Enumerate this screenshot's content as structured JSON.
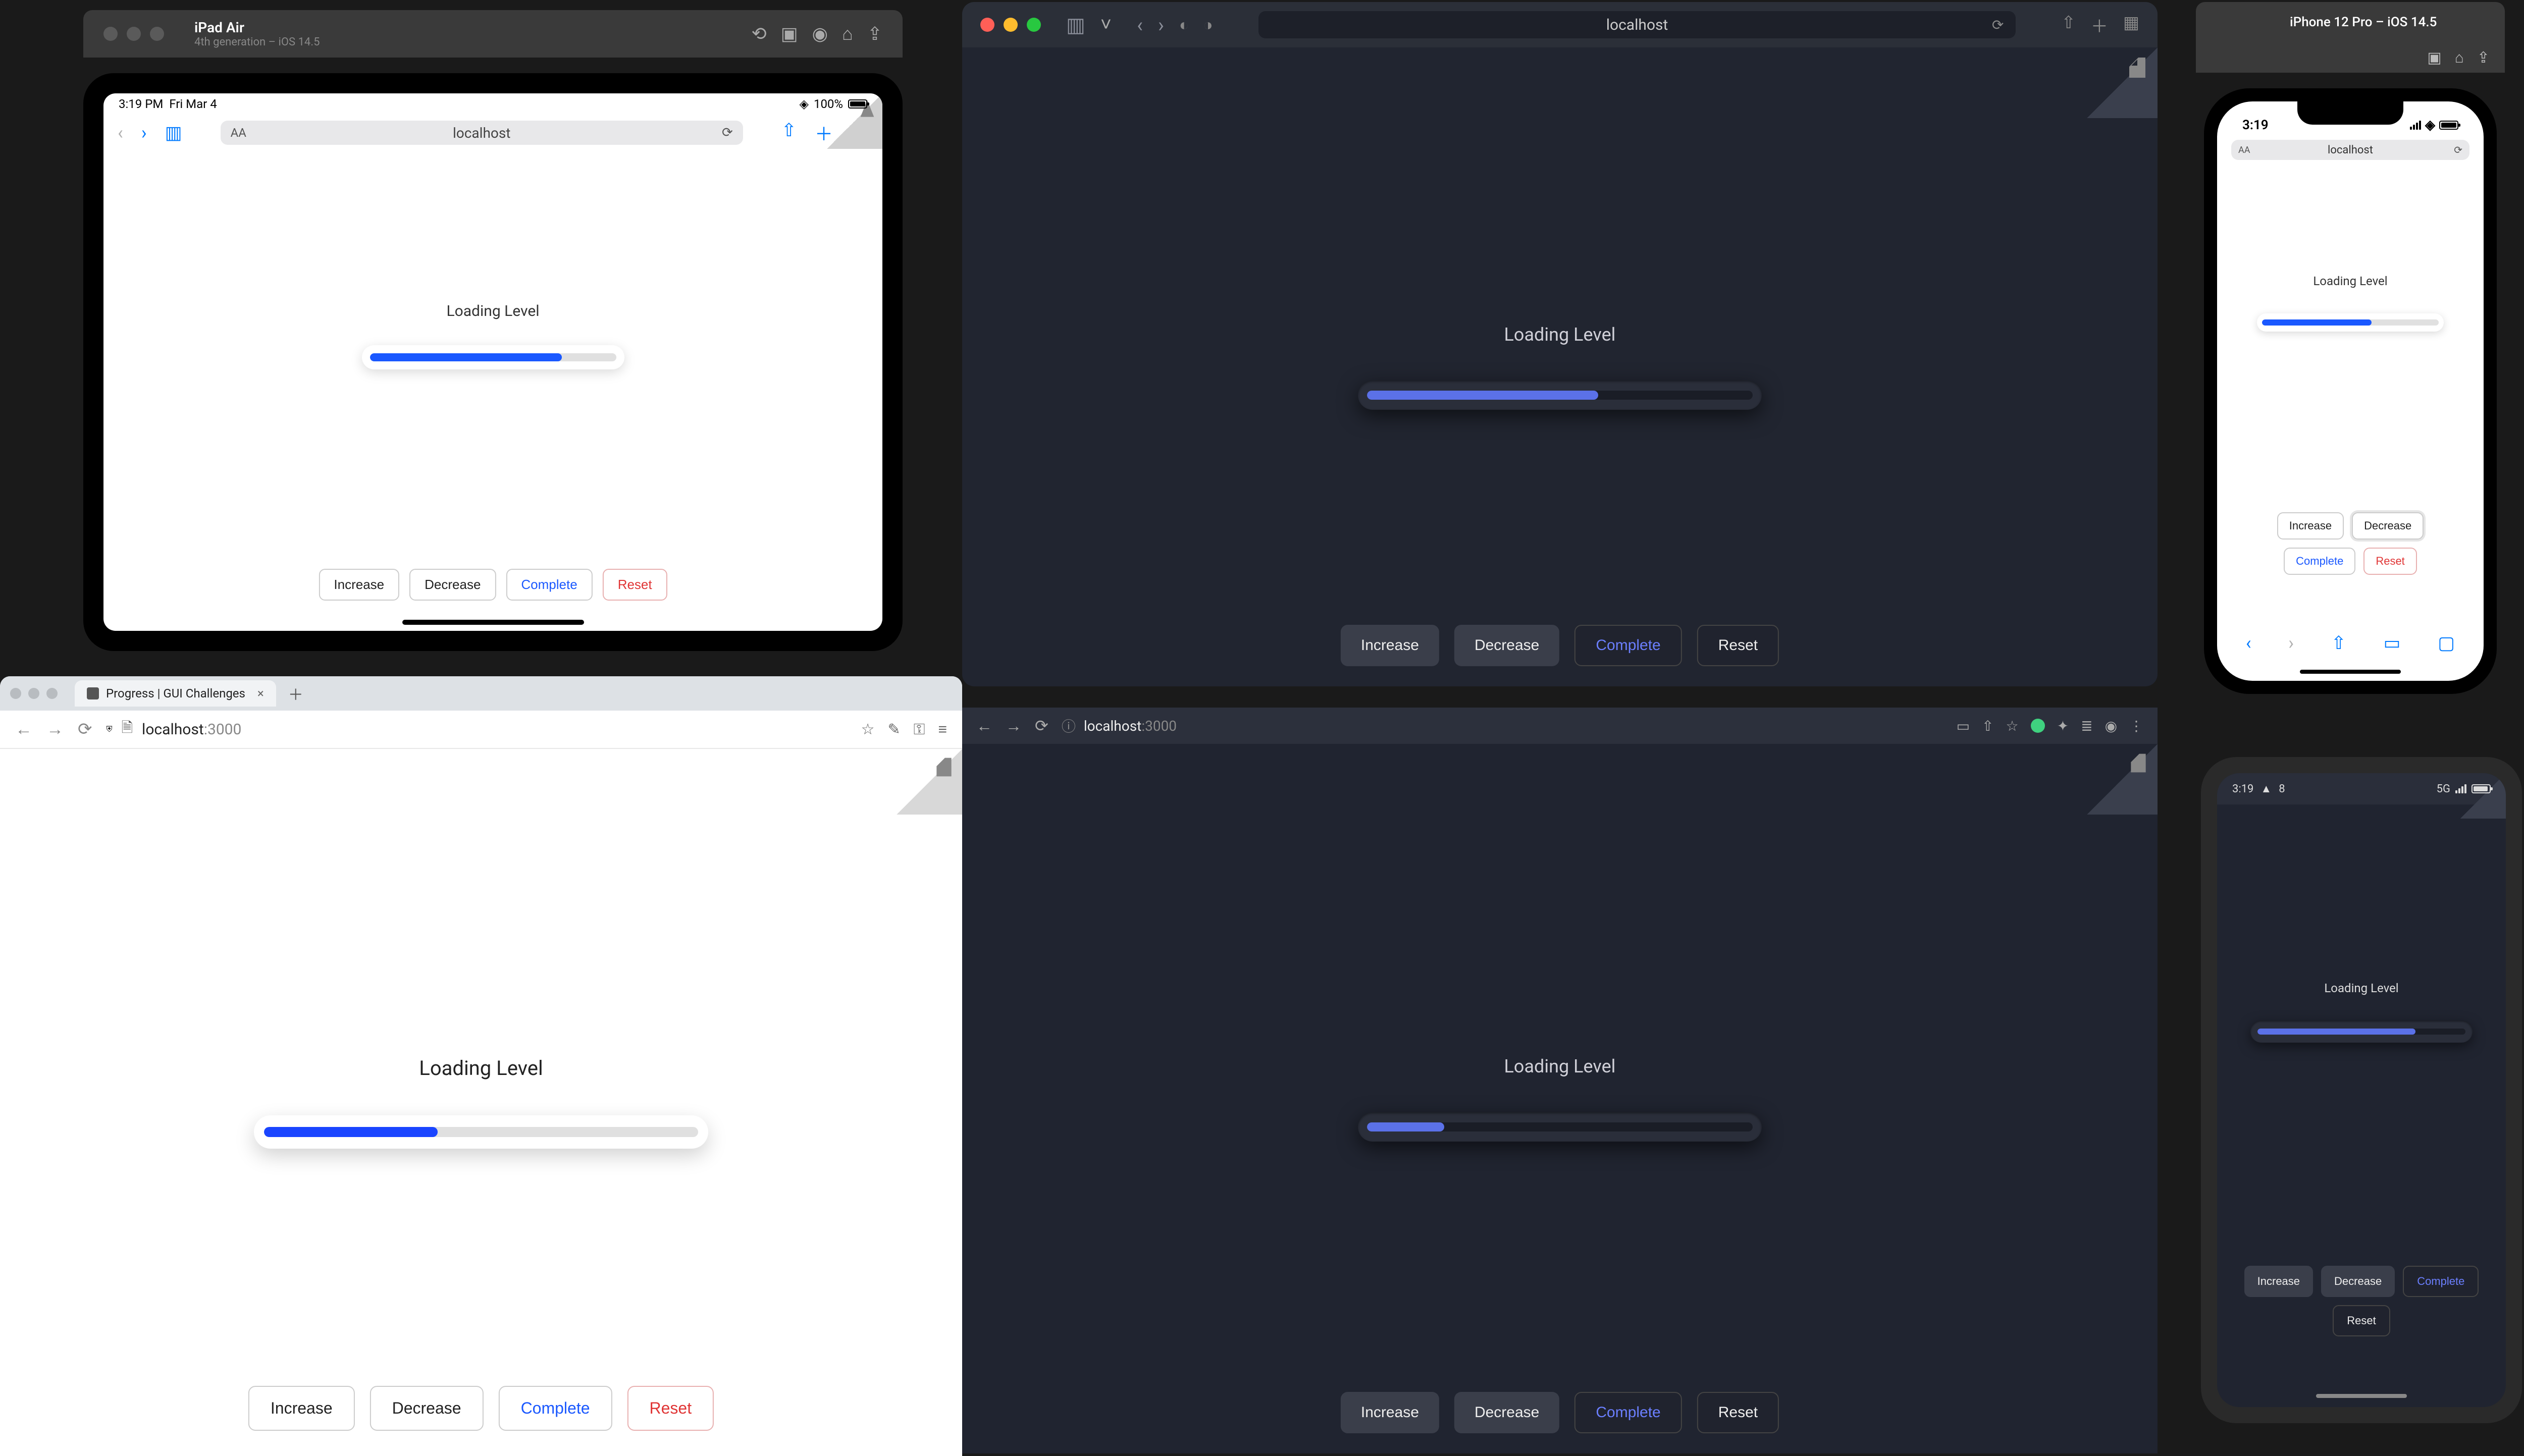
{
  "ipad": {
    "window_title": "iPad Air",
    "window_subtitle": "4th generation – iOS 14.5",
    "status_time": "3:19 PM",
    "status_date": "Fri Mar 4",
    "status_battery": "100%",
    "url": "localhost",
    "label": "Loading Level",
    "progress_pct": 78,
    "buttons": {
      "increase": "Increase",
      "decrease": "Decrease",
      "complete": "Complete",
      "reset": "Reset"
    }
  },
  "safari": {
    "url": "localhost",
    "label": "Loading Level",
    "progress_pct": 60,
    "buttons": {
      "increase": "Increase",
      "decrease": "Decrease",
      "complete": "Complete",
      "reset": "Reset"
    }
  },
  "iphone": {
    "window_title": "iPhone 12 Pro – iOS 14.5",
    "status_time": "3:19",
    "url": "localhost",
    "label": "Loading Level",
    "progress_pct": 62,
    "buttons": {
      "increase": "Increase",
      "decrease": "Decrease",
      "complete": "Complete",
      "reset": "Reset"
    }
  },
  "lightbrowser": {
    "tab_title": "Progress | GUI Challenges",
    "url_host": "localhost",
    "url_port": ":3000",
    "label": "Loading Level",
    "progress_pct": 40,
    "buttons": {
      "increase": "Increase",
      "decrease": "Decrease",
      "complete": "Complete",
      "reset": "Reset"
    }
  },
  "darkbrowser": {
    "url_host": "localhost",
    "url_port": ":3000",
    "label": "Loading Level",
    "progress_pct": 20,
    "buttons": {
      "increase": "Increase",
      "decrease": "Decrease",
      "complete": "Complete",
      "reset": "Reset"
    }
  },
  "android": {
    "status_time": "3:19",
    "status_temp": "8",
    "status_net": "5G",
    "label": "Loading Level",
    "progress_pct": 76,
    "buttons": {
      "increase": "Increase",
      "decrease": "Decrease",
      "complete": "Complete",
      "reset": "Reset"
    }
  }
}
